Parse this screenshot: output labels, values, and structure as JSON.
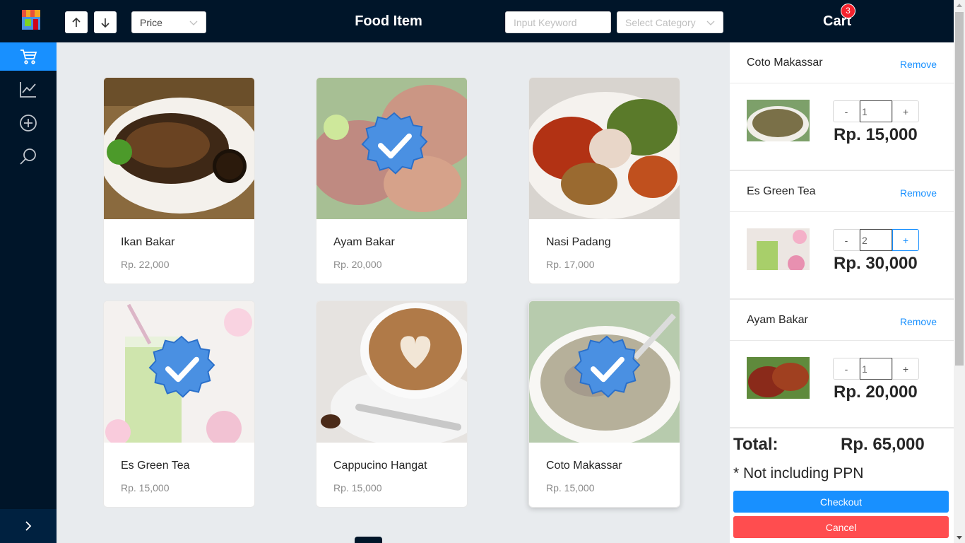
{
  "header": {
    "title": "Food Item",
    "sort_select": "Price",
    "keyword_placeholder": "Input Keyword",
    "category_placeholder": "Select Category",
    "cart_label": "Cart",
    "cart_count": "3"
  },
  "sidebar": {
    "items": [
      {
        "name": "cart-icon",
        "active": true
      },
      {
        "name": "chart-icon",
        "active": false
      },
      {
        "name": "add-icon",
        "active": false
      },
      {
        "name": "search-icon",
        "active": false
      }
    ]
  },
  "products": [
    {
      "name": "Ikan Bakar",
      "price": "Rp. 22,000",
      "selected": false
    },
    {
      "name": "Ayam Bakar",
      "price": "Rp. 20,000",
      "selected": true
    },
    {
      "name": "Nasi Padang",
      "price": "Rp. 17,000",
      "selected": false
    },
    {
      "name": "Es Green Tea",
      "price": "Rp. 15,000",
      "selected": true
    },
    {
      "name": "Cappucino Hangat",
      "price": "Rp. 15,000",
      "selected": false
    },
    {
      "name": "Coto Makassar",
      "price": "Rp. 15,000",
      "selected": true
    }
  ],
  "cart": {
    "remove_label": "Remove",
    "minus_label": "-",
    "plus_label": "+",
    "items": [
      {
        "name": "Coto Makassar",
        "qty": "1",
        "price": "Rp. 15,000"
      },
      {
        "name": "Es Green Tea",
        "qty": "2",
        "price": "Rp. 30,000"
      },
      {
        "name": "Ayam Bakar",
        "qty": "1",
        "price": "Rp. 20,000"
      }
    ],
    "total_label": "Total:",
    "total_value": "Rp. 65,000",
    "note": "* Not including PPN",
    "checkout_label": "Checkout",
    "cancel_label": "Cancel"
  },
  "colors": {
    "dark": "#001529",
    "primary": "#1890ff",
    "danger": "#ff4d4f",
    "badge": "#f5222d"
  }
}
